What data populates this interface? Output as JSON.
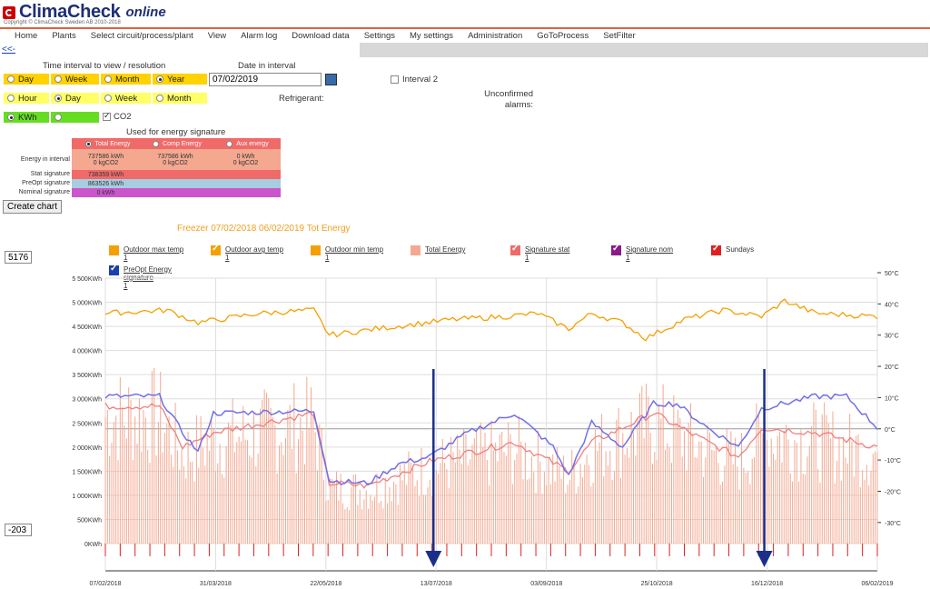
{
  "app": {
    "logo": "ClimaCheck",
    "logo_suffix": "online",
    "copyright": "Copyright © ClimaCheck Sweden AB 2010-2018"
  },
  "nav": [
    "Home",
    "Plants",
    "Select circuit/process/plant",
    "View",
    "Alarm log",
    "Download data",
    "Settings",
    "My settings",
    "Administration",
    "GoToProcess",
    "SetFilter"
  ],
  "back_link": "<<-",
  "time": {
    "heading": "Time interval to view / resolution",
    "interval": [
      {
        "label": "Day",
        "on": false
      },
      {
        "label": "Week",
        "on": false
      },
      {
        "label": "Month",
        "on": false
      },
      {
        "label": "Year",
        "on": true
      }
    ],
    "resolution": [
      {
        "label": "Hour",
        "on": false
      },
      {
        "label": "Day",
        "on": true
      },
      {
        "label": "Week",
        "on": false
      },
      {
        "label": "Month",
        "on": false
      }
    ],
    "unit": [
      {
        "label": "KWh",
        "on": true
      },
      {
        "label": "",
        "on": false
      }
    ],
    "co2_label": "CO2"
  },
  "date": {
    "heading": "Date in interval",
    "value": "07/02/2019"
  },
  "interval2_label": "Interval 2",
  "refrigerant_label": "Refrigerant:",
  "unconfirmed_label": "Unconfirmed alarms:",
  "energy_sig": {
    "heading": "Used for energy signature",
    "cols": [
      "Total Energy",
      "Comp Energy",
      "Aux energy"
    ],
    "row_labels": [
      "Energy in interval",
      "Stat signature",
      "PreOpt signature",
      "Nominal signature"
    ],
    "energy_kwh": [
      "737586 kWh",
      "737586 kWh",
      "0 kWh"
    ],
    "energy_co2": [
      "0 kgCO2",
      "0 kgCO2",
      "0 kgCO2"
    ],
    "stat": "738359 kWh",
    "preopt": "863526 kWh",
    "nominal": "0 kWh"
  },
  "create_chart_label": "Create chart",
  "chart": {
    "title": "Freezer 07/02/2018  06/02/2019 Tot Energy",
    "ymax_box": "5176",
    "ymin_box": "-203",
    "legend": [
      {
        "label": "Outdoor max temp",
        "sub": "1",
        "color": "#f5a000",
        "checked": false
      },
      {
        "label": "Outdoor avg temp",
        "sub": "1",
        "color": "#f5a000",
        "checked": true
      },
      {
        "label": "Outdoor min temp",
        "sub": "1",
        "color": "#f5a000",
        "checked": false
      },
      {
        "label": "Total Energy",
        "sub": "",
        "color": "#f4a890",
        "checked": false
      },
      {
        "label": "Signature stat",
        "sub": "1",
        "color": "#f06a6a",
        "checked": true
      },
      {
        "label": "Signature nom",
        "sub": "1",
        "color": "#8a1a8a",
        "checked": true
      },
      {
        "label": "Sundays",
        "sub": "",
        "color": "#e02020",
        "checked": true
      },
      {
        "label": "PreOpt Energy signature",
        "sub": "1",
        "color": "#1a3fb0",
        "checked": true
      }
    ]
  },
  "chart_data": {
    "type": "bar",
    "title": "Freezer 07/02/2018  06/02/2019 Tot Energy",
    "y_left": {
      "unit": "KWh",
      "ticks": [
        "5 500KWh",
        "5 000KWh",
        "4 500KWh",
        "4 000KWh",
        "3 500KWh",
        "3 000KWh",
        "2 500KWh",
        "2 000KWh",
        "1 500KWh",
        "1 000KWh",
        "500KWh",
        "0KWh"
      ],
      "range": [
        0,
        5500
      ]
    },
    "y_right": {
      "unit": "°C",
      "ticks": [
        "50°C",
        "40°C",
        "30°C",
        "20°C",
        "10°C",
        "0°C",
        "-10°C",
        "-20°C",
        "-30°C"
      ],
      "range": [
        -35,
        50
      ]
    },
    "x_ticks": [
      "07/02/2018",
      "31/03/2018",
      "22/05/2018",
      "13/07/2018",
      "03/09/2018",
      "25/10/2018",
      "16/12/2018",
      "06/02/2019"
    ],
    "grid": true,
    "series": [
      {
        "name": "Outdoor avg temp",
        "axis": "right",
        "key_values": [
          [
            0,
            37
          ],
          [
            0.08,
            38
          ],
          [
            0.12,
            34
          ],
          [
            0.2,
            37
          ],
          [
            0.27,
            38
          ],
          [
            0.29,
            30
          ],
          [
            0.35,
            32
          ],
          [
            0.45,
            35
          ],
          [
            0.52,
            36
          ],
          [
            0.56,
            37
          ],
          [
            0.6,
            32
          ],
          [
            0.63,
            37
          ],
          [
            0.67,
            34
          ],
          [
            0.7,
            29
          ],
          [
            0.75,
            35
          ],
          [
            0.8,
            38
          ],
          [
            0.85,
            36
          ],
          [
            0.88,
            41
          ],
          [
            0.92,
            37
          ],
          [
            1.0,
            36
          ]
        ]
      },
      {
        "name": "PreOpt Energy signature",
        "axis": "left",
        "key_values": [
          [
            0,
            3050
          ],
          [
            0.07,
            3050
          ],
          [
            0.1,
            2300
          ],
          [
            0.12,
            1900
          ],
          [
            0.14,
            2700
          ],
          [
            0.27,
            2750
          ],
          [
            0.29,
            1300
          ],
          [
            0.34,
            1250
          ],
          [
            0.38,
            1650
          ],
          [
            0.42,
            1800
          ],
          [
            0.47,
            2300
          ],
          [
            0.53,
            2700
          ],
          [
            0.58,
            2000
          ],
          [
            0.6,
            1400
          ],
          [
            0.63,
            2500
          ],
          [
            0.67,
            2000
          ],
          [
            0.71,
            2900
          ],
          [
            0.74,
            2900
          ],
          [
            0.78,
            2400
          ],
          [
            0.82,
            2000
          ],
          [
            0.85,
            2800
          ],
          [
            0.92,
            3050
          ],
          [
            0.96,
            3050
          ],
          [
            1.0,
            2400
          ]
        ]
      },
      {
        "name": "Signature stat",
        "axis": "left",
        "key_values": [
          [
            0,
            2850
          ],
          [
            0.07,
            2850
          ],
          [
            0.1,
            2000
          ],
          [
            0.14,
            2300
          ],
          [
            0.27,
            2700
          ],
          [
            0.29,
            1250
          ],
          [
            0.34,
            1200
          ],
          [
            0.42,
            1700
          ],
          [
            0.53,
            2100
          ],
          [
            0.6,
            1500
          ],
          [
            0.63,
            2100
          ],
          [
            0.71,
            2700
          ],
          [
            0.78,
            2100
          ],
          [
            0.82,
            1800
          ],
          [
            0.85,
            2400
          ],
          [
            0.92,
            2300
          ],
          [
            1.0,
            2000
          ]
        ]
      },
      {
        "name": "Total Energy",
        "axis": "left",
        "type": "bar",
        "note": "daily bars, values approx 1000–3500 KWh following signature shape"
      }
    ],
    "annotations": [
      {
        "type": "arrow",
        "x_tick": "13/07/2018"
      },
      {
        "type": "arrow",
        "x_tick": "16/12/2018"
      }
    ]
  }
}
